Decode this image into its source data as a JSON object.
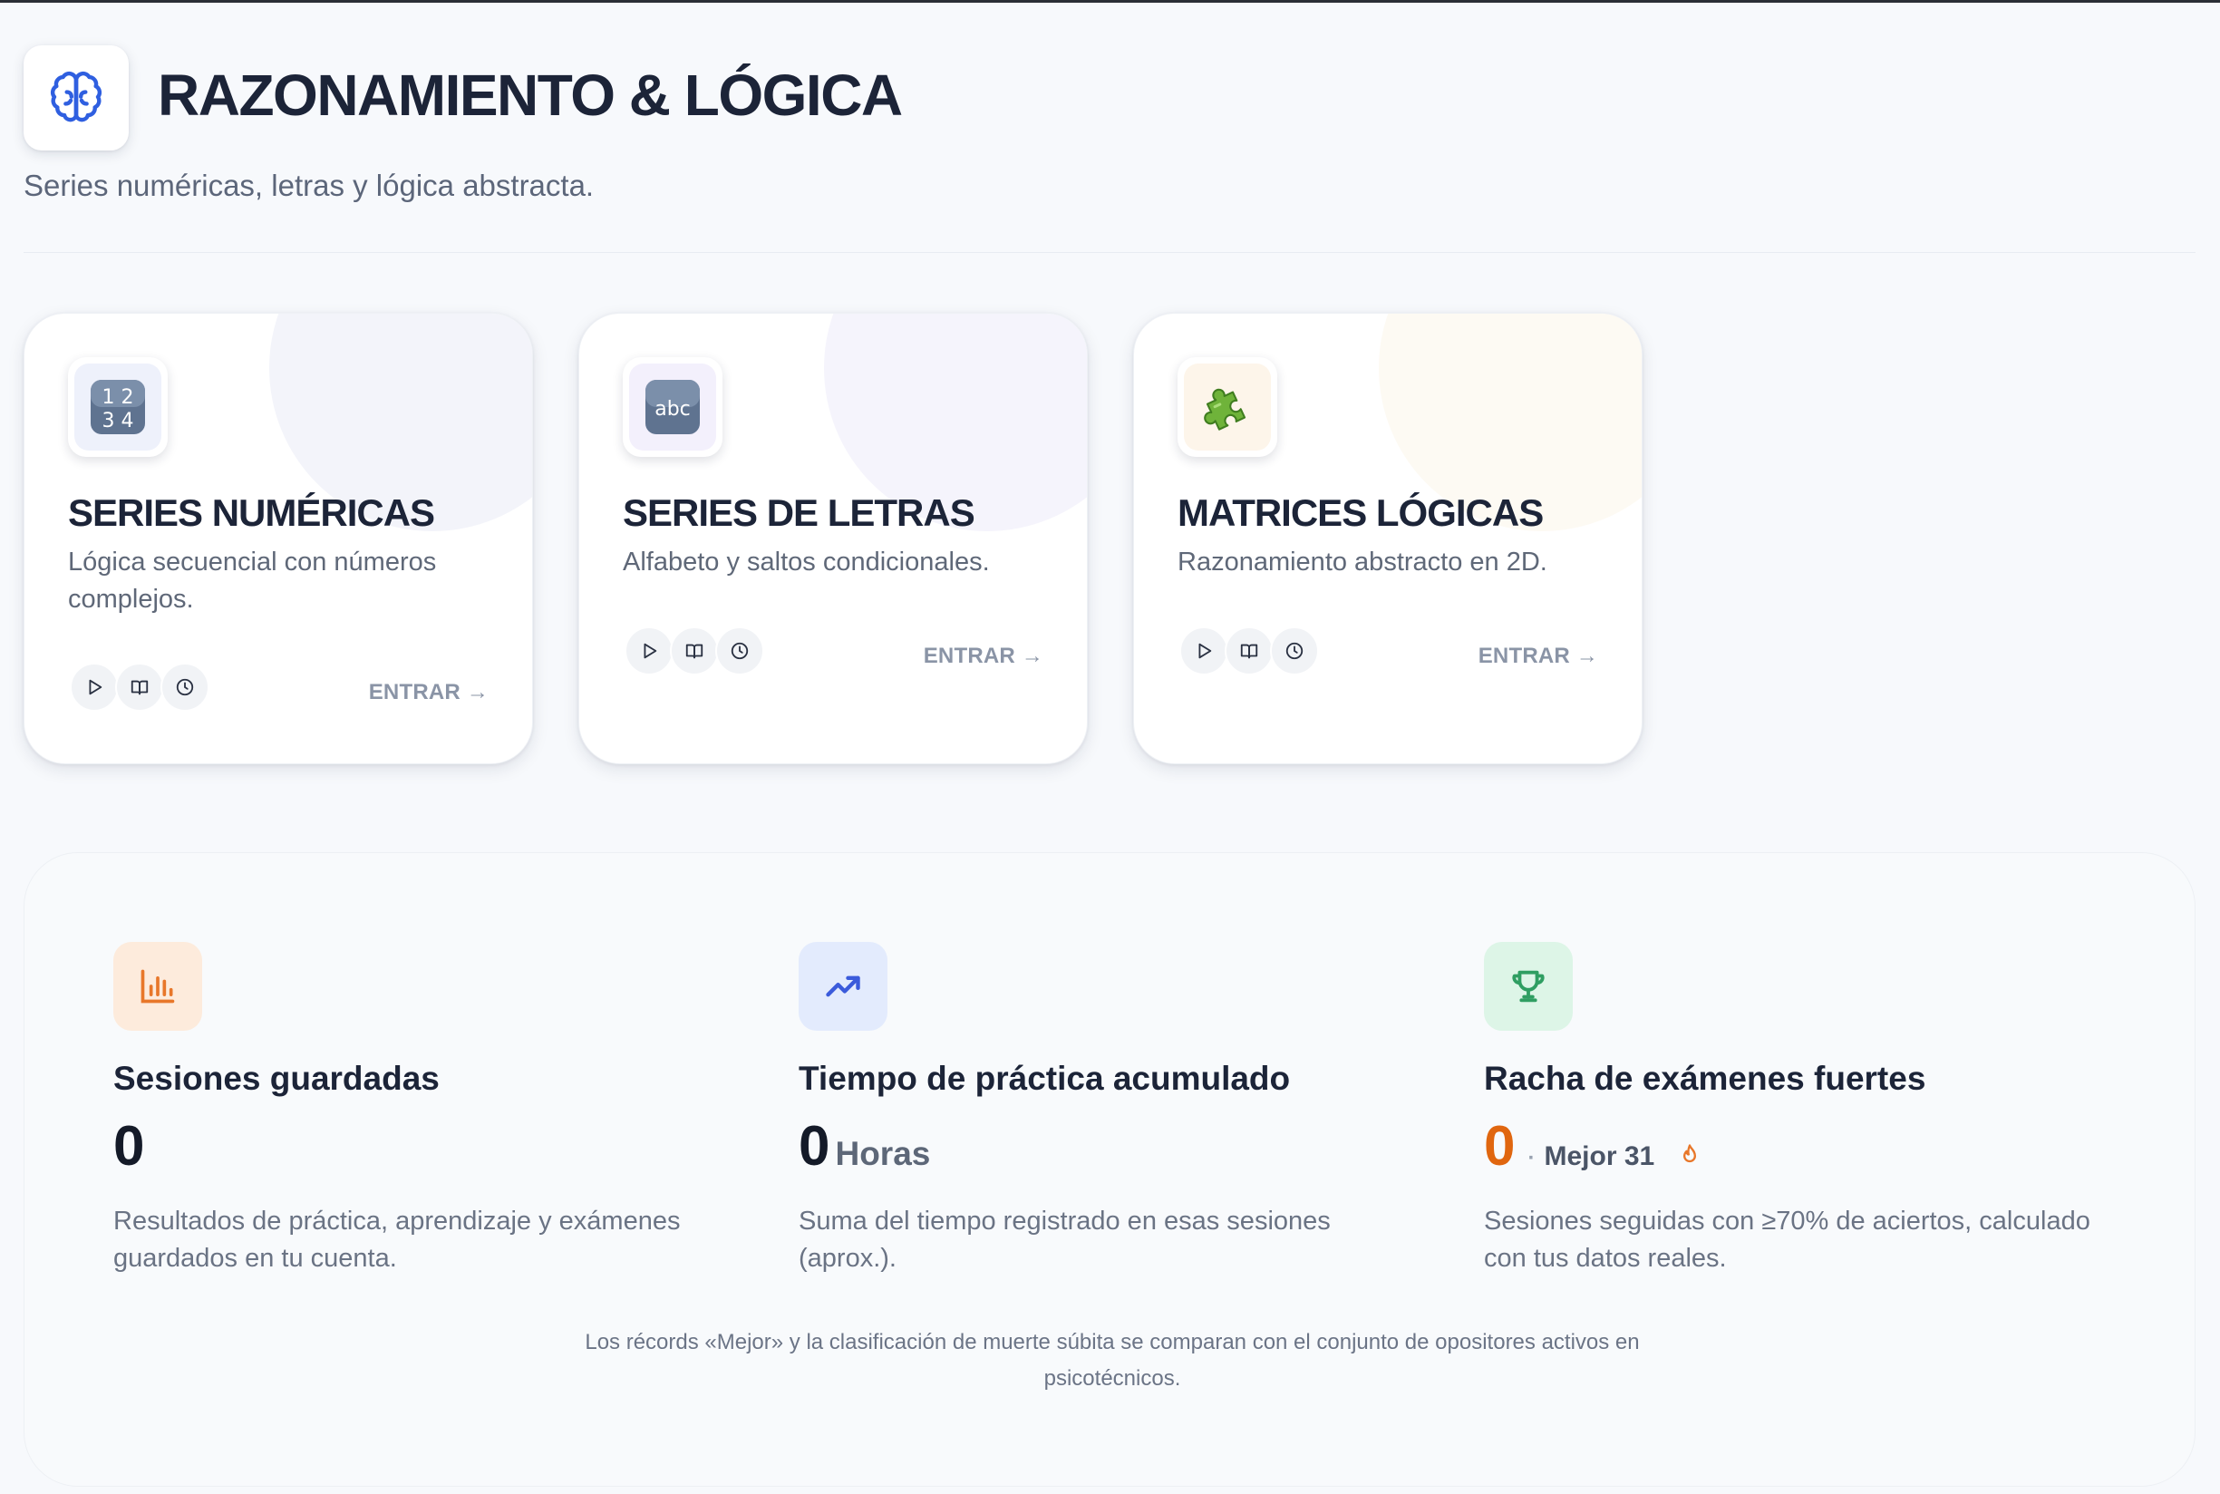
{
  "header": {
    "icon": "brain-icon",
    "title": "RAZONAMIENTO & LÓGICA",
    "subtitle": "Series numéricas, letras y lógica abstracta."
  },
  "cards": [
    {
      "icon": "numbers-1234-icon",
      "title": "SERIES NUMÉRICAS",
      "description": "Lógica secuencial con números complejos.",
      "enter_label": "ENTRAR",
      "accent": "#eef0fb"
    },
    {
      "icon": "abc-letters-icon",
      "title": "SERIES DE LETRAS",
      "description": "Alfabeto y saltos condicionales.",
      "enter_label": "ENTRAR",
      "accent": "#f3f1fc"
    },
    {
      "icon": "puzzle-piece-icon",
      "title": "MATRICES LÓGICAS",
      "description": "Razonamiento abstracto en 2D.",
      "enter_label": "ENTRAR",
      "accent": "#fdf8ef"
    }
  ],
  "stats": [
    {
      "icon": "bar-chart-icon",
      "title": "Sesiones guardadas",
      "value": "0",
      "description": "Resultados de práctica, aprendizaje y exámenes guardados en tu cuenta.",
      "color": "#e8772a"
    },
    {
      "icon": "trending-up-icon",
      "title": "Tiempo de práctica acumulado",
      "value": "0",
      "unit": "Horas",
      "description": "Suma del tiempo registrado en esas sesiones (aprox.).",
      "color": "#3b5bdb"
    },
    {
      "icon": "trophy-icon",
      "title": "Racha de exámenes fuertes",
      "value": "0",
      "best_separator": "·",
      "best_label": "Mejor 31",
      "best_icon": "flame-icon",
      "description": "Sesiones seguidas con ≥70% de aciertos, calculado con tus datos reales.",
      "color": "#2f9e62"
    }
  ],
  "footnote": "Los récords «Mejor» y la clasificación de muerte súbita se comparan con el conjunto de opositores activos en psicotécnicos.",
  "colors": {
    "value_streak": "#e0660f",
    "title": "#1c2438"
  }
}
